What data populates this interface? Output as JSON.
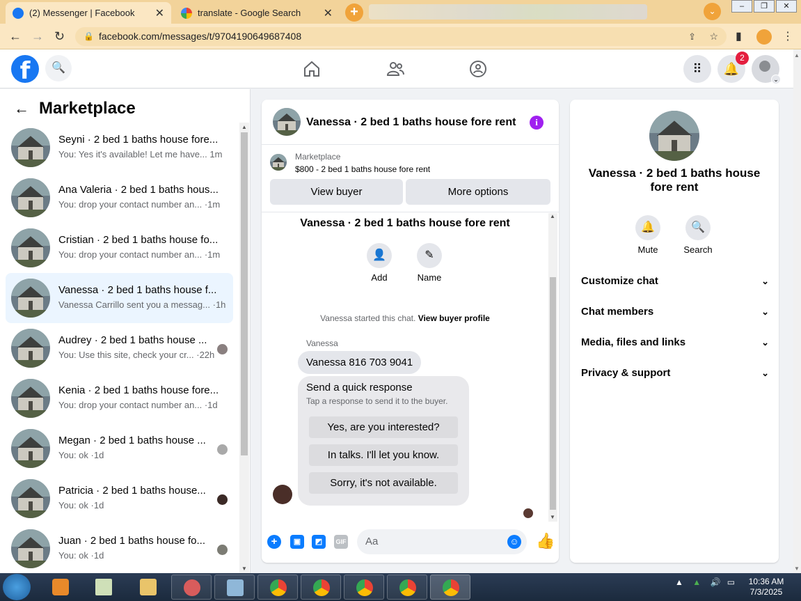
{
  "browser": {
    "tabs": [
      {
        "title": "(2) Messenger | Facebook",
        "active": true
      },
      {
        "title": "translate - Google Search",
        "active": false
      }
    ],
    "url": "facebook.com/messages/t/9704190649687408"
  },
  "fb": {
    "notifications_count": "2"
  },
  "sidebar": {
    "title": "Marketplace",
    "conversations": [
      {
        "title": "Seyni · 2 bed 1 baths house fore...",
        "preview": "You: Yes it's available! Let me have...",
        "time": "1m"
      },
      {
        "title": "Ana Valeria · 2 bed 1 baths hous...",
        "preview": "You: drop your contact number an...",
        "time": "1m"
      },
      {
        "title": "Cristian · 2 bed 1 baths house fo...",
        "preview": "You: drop your contact number an...",
        "time": "1m"
      },
      {
        "title": "Vanessa · 2 bed 1 baths house f...",
        "preview": "Vanessa Carrillo sent you a messag...",
        "time": "1h"
      },
      {
        "title": "Audrey · 2 bed 1 baths house ...",
        "preview": "You: Use this site, check your cr...",
        "time": "22h"
      },
      {
        "title": "Kenia · 2 bed 1 baths house fore...",
        "preview": "You: drop your contact number an...",
        "time": "1d"
      },
      {
        "title": "Megan · 2 bed 1 baths house ...",
        "preview": "You: ok",
        "time": "1d"
      },
      {
        "title": "Patricia · 2 bed 1 baths house...",
        "preview": "You: ok",
        "time": "1d"
      },
      {
        "title": "Juan · 2 bed 1 baths house fo...",
        "preview": "You: ok",
        "time": "1d"
      }
    ]
  },
  "chat": {
    "header_title": "Vanessa · 2 bed 1 baths house fore rent",
    "marketplace_label": "Marketplace",
    "listing": "$800 - 2 bed 1 baths house fore rent",
    "view_buyer": "View buyer",
    "more_options": "More options",
    "intro_title": "Vanessa · 2 bed 1 baths house fore rent",
    "add_label": "Add",
    "name_label": "Name",
    "started_text": "Vanessa started this chat.",
    "view_buyer_profile": "View buyer profile",
    "sender": "Vanessa",
    "message": "Vanessa 816 703 9041",
    "quick_title": "Send a quick response",
    "quick_sub": "Tap a response to send it to the buyer.",
    "quick_replies": [
      "Yes, are you interested?",
      "In talks. I'll let you know.",
      "Sorry, it's not available."
    ],
    "composer_placeholder": "Aa",
    "gif_label": "GIF"
  },
  "details": {
    "name": "Vanessa · 2 bed 1 baths house fore rent",
    "mute": "Mute",
    "search": "Search",
    "sections": [
      "Customize chat",
      "Chat members",
      "Media, files and links",
      "Privacy & support"
    ]
  },
  "taskbar": {
    "time": "10:36 AM",
    "date": "7/3/2025"
  }
}
